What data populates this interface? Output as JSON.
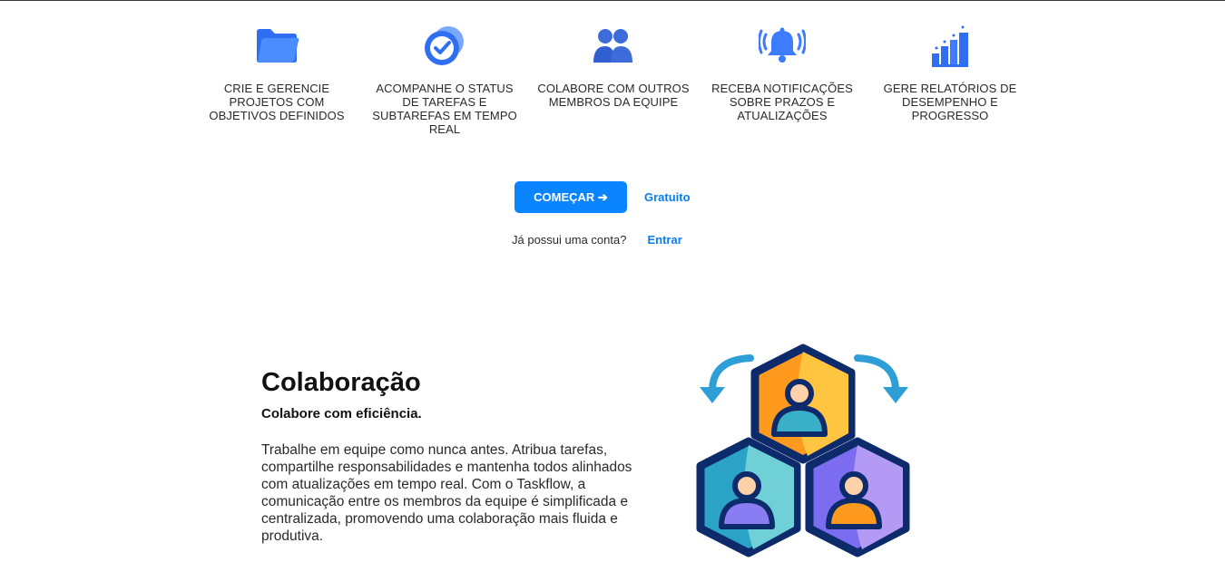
{
  "features": [
    {
      "icon": "folder-icon",
      "text": "CRIE E GERENCIE PROJETOS COM OBJETIVOS DEFINIDOS"
    },
    {
      "icon": "check-circle-icon",
      "text": "ACOMPANHE O STATUS DE TAREFAS E SUBTAREFAS EM TEMPO REAL"
    },
    {
      "icon": "users-icon",
      "text": "COLABORE COM OUTROS MEMBROS DA EQUIPE"
    },
    {
      "icon": "bell-icon",
      "text": "RECEBA NOTIFICAÇÕES SOBRE PRAZOS E ATUALIZAÇÕES"
    },
    {
      "icon": "bar-chart-icon",
      "text": "GERE RELATÓRIOS DE DESEMPENHO E PROGRESSO"
    }
  ],
  "cta": {
    "start_label": "COMEÇAR ➔",
    "free_label": "Gratuito",
    "account_question": "Já possui uma conta?",
    "login_label": "Entrar"
  },
  "collaboration": {
    "title": "Colaboração",
    "subtitle": "Colabore com eficiência.",
    "body": "Trabalhe em equipe como nunca antes. Atribua tarefas, compartilhe responsabilidades e mantenha todos alinhados com atualizações em tempo real. Com o Taskflow, a comunicação entre os membros da equipe é simplificada e centralizada, promovendo uma colaboração mais fluida e produtiva."
  },
  "colors": {
    "accent": "#0a84ff",
    "icon_blue": "#3d7bff",
    "illus_orange": "#ff9a1f",
    "illus_teal": "#3ab0c8",
    "illus_purple": "#7b6cf0",
    "illus_navy": "#0d2a6b"
  }
}
